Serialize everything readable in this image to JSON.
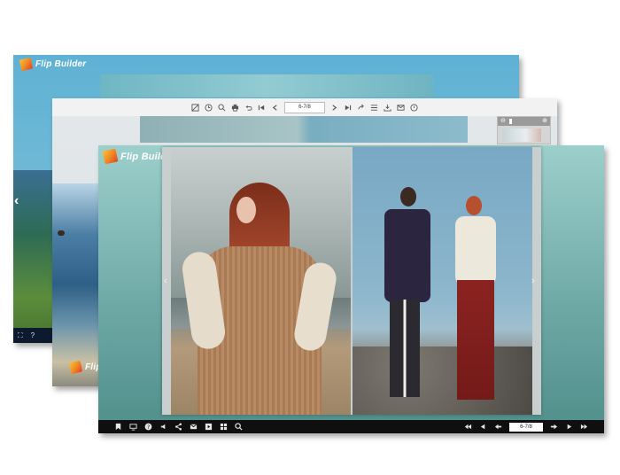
{
  "brand": {
    "name": "Flip Builder"
  },
  "front": {
    "page_indicator": "6-7/8",
    "toolbar_left_icons": [
      "bookmark-icon",
      "screen-icon",
      "help-icon",
      "sound-icon",
      "share-icon",
      "email-icon",
      "film-icon",
      "grid-icon",
      "zoom-icon"
    ],
    "toolbar_right_icons": [
      "first-page-icon",
      "prev-page-icon",
      "back-icon"
    ],
    "toolbar_right_icons_after": [
      "forward-icon",
      "next-page-icon",
      "last-page-icon"
    ]
  },
  "middle": {
    "page_indicator": "6-7/8",
    "toolbar_icons_left": [
      "crop-icon",
      "clock-icon",
      "zoom-icon",
      "print-icon",
      "undo-icon",
      "first-page-icon",
      "prev-page-icon"
    ],
    "toolbar_icons_right": [
      "next-page-icon",
      "last-page-icon",
      "share-icon",
      "list-icon",
      "download-icon",
      "email-icon",
      "timer-icon"
    ]
  },
  "colors": {
    "front_bg": "#75adaa",
    "front_toolbar": "#101010",
    "middle_toolbar": "#f2f2f2",
    "back_bg": "#5aa7c7"
  }
}
